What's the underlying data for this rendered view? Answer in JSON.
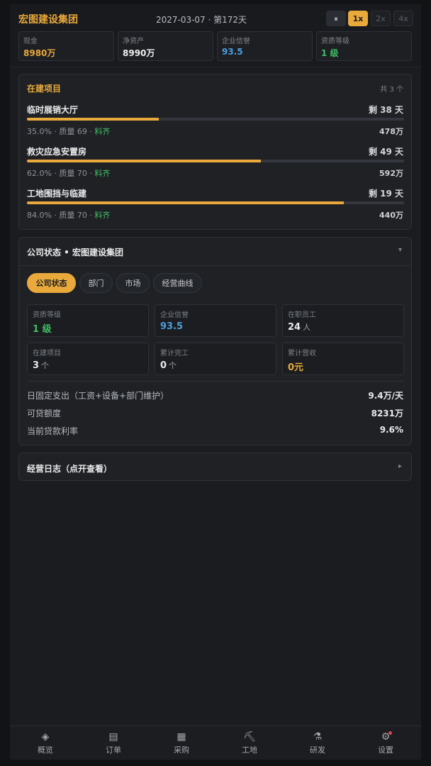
{
  "header": {
    "company": "宏图建设集团",
    "date": "2027-03-07 · 第172天",
    "speed": {
      "pause": "⏸",
      "x1": "1x",
      "x2": "2x",
      "x4": "4x",
      "active": "1x"
    },
    "stats": [
      {
        "label": "现金",
        "value": "8980万",
        "color": "#e9a93b"
      },
      {
        "label": "净资产",
        "value": "8990万",
        "color": "#f0f0f0"
      },
      {
        "label": "企业信誉",
        "value": "93.5",
        "color": "#4a9fe0"
      },
      {
        "label": "资质等级",
        "value": "1 级",
        "color": "#3fbf64"
      }
    ]
  },
  "projects": {
    "title": "在建项目",
    "count": "共 3 个",
    "items": [
      {
        "name": "临时展销大厅",
        "remaining": "剩 38 天",
        "progress": 0.35,
        "meta": "35.0% · 质量 69 · ",
        "material": "料齐",
        "amount": "478万"
      },
      {
        "name": "救灾应急安置房",
        "remaining": "剩 49 天",
        "progress": 0.62,
        "meta": "62.0% · 质量 70 · ",
        "material": "料齐",
        "amount": "592万"
      },
      {
        "name": "工地围挡与临建",
        "remaining": "剩 19 天",
        "progress": 0.84,
        "meta": "84.0% · 质量 70 · ",
        "material": "料齐",
        "amount": "440万"
      }
    ]
  },
  "status": {
    "title": "公司状态 • 宏图建设集团",
    "caret": "▾",
    "tabs": [
      "公司状态",
      "部门",
      "市场",
      "经营曲线"
    ],
    "metrics": [
      {
        "label": "资质等级",
        "value": "1 级",
        "unit": "",
        "color": "#3fbf64"
      },
      {
        "label": "企业信誉",
        "value": "93.5",
        "unit": "",
        "color": "#4a9fe0"
      },
      {
        "label": "在职员工",
        "value": "24",
        "unit": "人",
        "color": "#eaeaea"
      },
      {
        "label": "在建项目",
        "value": "3",
        "unit": "个",
        "color": "#eaeaea"
      },
      {
        "label": "累计完工",
        "value": "0",
        "unit": "个",
        "color": "#eaeaea"
      },
      {
        "label": "累计营收",
        "value": "0元",
        "unit": "",
        "color": "#e9a93b"
      }
    ],
    "rows": [
      {
        "label": "日固定支出（工资+设备+部门维护）",
        "value": "9.4万/天"
      },
      {
        "label": "可贷额度",
        "value": "8231万"
      },
      {
        "label": "当前贷款利率",
        "value": "9.6%"
      }
    ]
  },
  "log": {
    "title": "经营日志（点开查看）",
    "caret": "▸"
  },
  "nav": [
    {
      "label": "概览",
      "icon": "◈",
      "active": true
    },
    {
      "label": "订单",
      "icon": "▤",
      "active": false
    },
    {
      "label": "采购",
      "icon": "▦",
      "active": false
    },
    {
      "label": "工地",
      "icon": "⛏",
      "active": false
    },
    {
      "label": "研发",
      "icon": "⚗",
      "active": false
    },
    {
      "label": "设置",
      "icon": "⚙",
      "active": false,
      "badge": true
    }
  ]
}
